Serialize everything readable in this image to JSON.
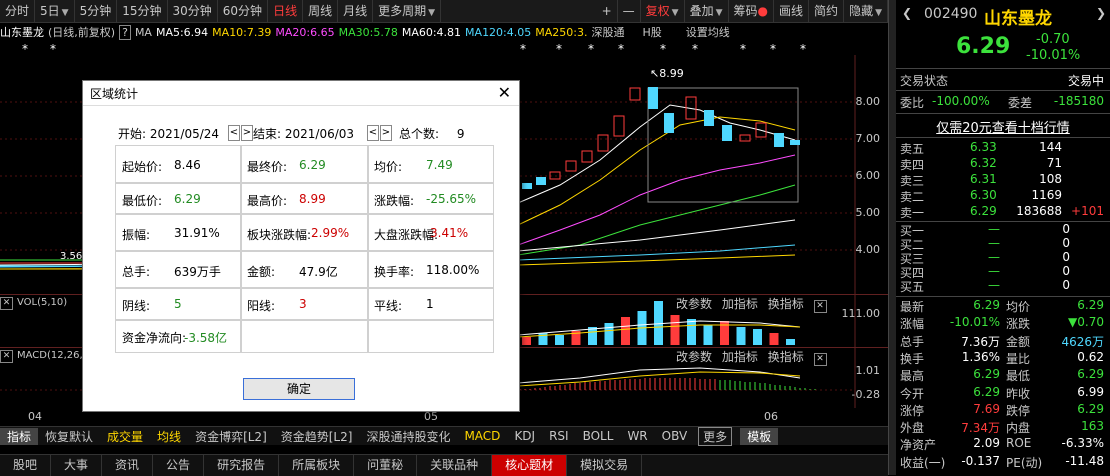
{
  "toolbar": {
    "items": [
      "分时",
      "5日",
      "5分钟",
      "15分钟",
      "30分钟",
      "60分钟",
      "日线",
      "周线",
      "月线",
      "更多周期"
    ],
    "right_items": [
      "+",
      "—",
      "复权",
      "叠加",
      "筹码",
      "画线",
      "简约",
      "隐藏"
    ]
  },
  "ma_line": {
    "name": "山东墨龙",
    "mode": "(日线,前复权)",
    "q": "?",
    "ma_label": "MA",
    "ma5": "MA5:6.94",
    "ma10": "MA10:7.39",
    "ma20": "MA20:6.65",
    "ma30": "MA30:5.78",
    "ma60": "MA60:4.81",
    "ma120": "MA120:4.05",
    "ma250": "MA250:3.",
    "sz": "深股通",
    "h": "H股",
    "setting": "设置均线"
  },
  "chart": {
    "high_marker": "8.99",
    "low_marker": "3.56",
    "y_labels": [
      "8.00",
      "7.00",
      "6.00",
      "5.00",
      "4.00"
    ],
    "x_labels": [
      "04",
      "05",
      "06"
    ]
  },
  "vol_panel": {
    "head": "VOL(5,10)",
    "right_label": "111.00",
    "controls": [
      "改参数",
      "加指标",
      "换指标"
    ]
  },
  "macd_panel": {
    "head": "MACD(12,26,9)",
    "right_label_top": "1.01",
    "right_label_bottom": "-0.28",
    "controls": [
      "改参数",
      "加指标",
      "换指标"
    ]
  },
  "tabs1": [
    "指标",
    "恢复默认",
    "成交量",
    "均线",
    "资金博弈[L2]",
    "资金趋势[L2]",
    "深股通持股变化",
    "MACD",
    "KDJ",
    "RSI",
    "BOLL",
    "WR",
    "OBV",
    "更多",
    "模板"
  ],
  "tabs2": [
    "股吧",
    "大事",
    "资讯",
    "公告",
    "研究报告",
    "所属板块",
    "问董秘",
    "关联品种",
    "核心题材",
    "模拟交易"
  ],
  "right_panel": {
    "code": "002490",
    "name": "山东墨龙",
    "price": "6.29",
    "change": "-0.70",
    "change_pct": "-10.01%",
    "status_label": "交易状态",
    "status_value": "交易中",
    "weibi_label": "委比",
    "weibi_value": "-100.00%",
    "weicha_label": "委差",
    "weicha_value": "-185180",
    "promo": "仅需20元查看十档行情",
    "asks": [
      {
        "label": "卖五",
        "price": "6.33",
        "vol": "144",
        "extra": ""
      },
      {
        "label": "卖四",
        "price": "6.32",
        "vol": "71",
        "extra": ""
      },
      {
        "label": "卖三",
        "price": "6.31",
        "vol": "108",
        "extra": ""
      },
      {
        "label": "卖二",
        "price": "6.30",
        "vol": "1169",
        "extra": ""
      },
      {
        "label": "卖一",
        "price": "6.29",
        "vol": "183688",
        "extra": "+101"
      }
    ],
    "bids": [
      {
        "label": "买一",
        "price": "—",
        "vol": "0"
      },
      {
        "label": "买二",
        "price": "—",
        "vol": "0"
      },
      {
        "label": "买三",
        "price": "—",
        "vol": "0"
      },
      {
        "label": "买四",
        "price": "—",
        "vol": "0"
      },
      {
        "label": "买五",
        "price": "—",
        "vol": "0"
      }
    ],
    "stats": [
      {
        "l1": "最新",
        "v1": "6.29",
        "c1": "green",
        "l2": "均价",
        "v2": "6.29",
        "c2": "green"
      },
      {
        "l1": "涨幅",
        "v1": "-10.01%",
        "c1": "green",
        "l2": "涨跌",
        "v2": "▼0.70",
        "c2": "green"
      },
      {
        "l1": "总手",
        "v1": "7.36万",
        "c1": "white",
        "l2": "金额",
        "v2": "4626万",
        "c2": "cyan"
      },
      {
        "l1": "换手",
        "v1": "1.36%",
        "c1": "white",
        "l2": "量比",
        "v2": "0.62",
        "c2": "white"
      },
      {
        "l1": "最高",
        "v1": "6.29",
        "c1": "green",
        "l2": "最低",
        "v2": "6.29",
        "c2": "green"
      },
      {
        "l1": "今开",
        "v1": "6.29",
        "c1": "green",
        "l2": "昨收",
        "v2": "6.99",
        "c2": "white"
      },
      {
        "l1": "涨停",
        "v1": "7.69",
        "c1": "red",
        "l2": "跌停",
        "v2": "6.29",
        "c2": "green"
      },
      {
        "l1": "外盘",
        "v1": "7.34万",
        "c1": "red",
        "l2": "内盘",
        "v2": "163",
        "c2": "green"
      },
      {
        "l1": "净资产",
        "v1": "2.09",
        "c1": "white",
        "l2": "ROE",
        "v2": "-6.33%",
        "c2": "white"
      },
      {
        "l1": "收益(一)",
        "v1": "-0.137",
        "c1": "white",
        "l2": "PE(动)",
        "v2": "-11.48",
        "c2": "white"
      }
    ]
  },
  "dialog": {
    "title": "区域统计",
    "start_label": "开始:",
    "start_date": "2021/05/24",
    "end_label": "结束:",
    "end_date": "2021/06/03",
    "count_label": "总个数:",
    "count_value": "9",
    "rows": [
      [
        {
          "l": "起始价:",
          "v": "8.46",
          "c": ""
        },
        {
          "l": "最终价:",
          "v": "6.29",
          "c": "g"
        },
        {
          "l": "均价:",
          "v": "7.49",
          "c": "g"
        }
      ],
      [
        {
          "l": "最低价:",
          "v": "6.29",
          "c": "g"
        },
        {
          "l": "最高价:",
          "v": "8.99",
          "c": "r"
        },
        {
          "l": "涨跌幅:",
          "v": "-25.65%",
          "c": "g"
        }
      ],
      [
        {
          "l": "振幅:",
          "v": "31.91%",
          "c": ""
        },
        {
          "l": "板块涨跌幅:",
          "v": "2.99%",
          "c": "r"
        },
        {
          "l": "大盘涨跌幅:",
          "v": "3.41%",
          "c": "r"
        }
      ],
      [
        {
          "l": "总手:",
          "v": "639万手",
          "c": ""
        },
        {
          "l": "金额:",
          "v": "47.9亿",
          "c": ""
        },
        {
          "l": "换手率:",
          "v": "118.00%",
          "c": ""
        }
      ],
      [
        {
          "l": "阴线:",
          "v": "5",
          "c": "g"
        },
        {
          "l": "阳线:",
          "v": "3",
          "c": "r"
        },
        {
          "l": "平线:",
          "v": "1",
          "c": ""
        }
      ],
      [
        {
          "l": "资金净流向:",
          "v": "-3.58亿",
          "c": "g"
        },
        {
          "l": "",
          "v": "",
          "c": ""
        },
        {
          "l": "",
          "v": "",
          "c": ""
        }
      ]
    ],
    "ok_label": "确定"
  }
}
